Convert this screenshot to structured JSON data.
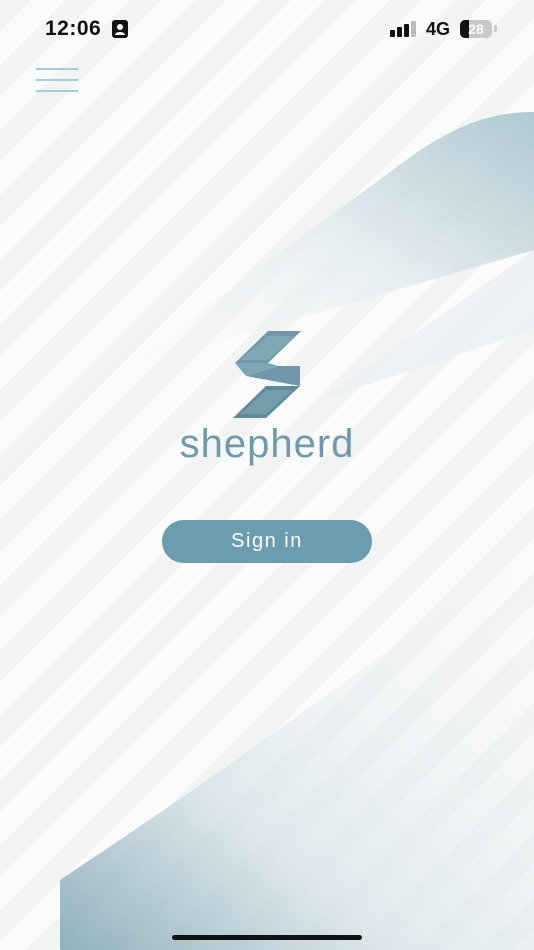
{
  "status_bar": {
    "time": "12:06",
    "contact_icon": "contact-card-icon",
    "signal_icon": "cellular-signal-icon",
    "network": "4G",
    "battery_level": "28"
  },
  "menu": {
    "icon": "hamburger-menu-icon"
  },
  "brand": {
    "logo_icon": "shepherd-s-logo-icon",
    "name": "shepherd"
  },
  "actions": {
    "sign_in_label": "Sign in"
  },
  "colors": {
    "accent": "#6c9caf",
    "brand_text": "#6f9aab",
    "menu_lines": "#a9cbd7",
    "background": "#f7f8f8"
  }
}
